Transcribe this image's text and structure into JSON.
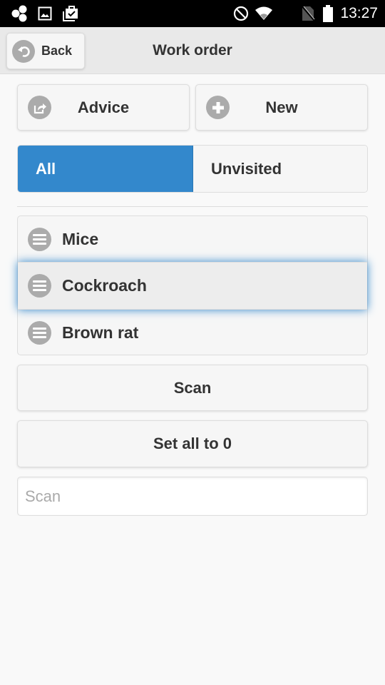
{
  "status_bar": {
    "time": "13:27",
    "icons": [
      "app-notification-icon",
      "image-notification-icon",
      "clipboard-check-icon",
      "do-not-disturb-icon",
      "wifi-icon",
      "no-sim-icon",
      "battery-icon"
    ]
  },
  "header": {
    "back_label": "Back",
    "title": "Work order"
  },
  "actions": {
    "advice_label": "Advice",
    "new_label": "New"
  },
  "filter_tabs": [
    {
      "label": "All",
      "active": true
    },
    {
      "label": "Unvisited",
      "active": false
    }
  ],
  "pest_list": [
    {
      "label": "Mice",
      "focused": false
    },
    {
      "label": "Cockroach",
      "focused": true
    },
    {
      "label": "Brown rat",
      "focused": false
    }
  ],
  "buttons": {
    "scan_label": "Scan",
    "set_all_label": "Set all to 0"
  },
  "scan_input": {
    "value": "",
    "placeholder": "Scan"
  },
  "colors": {
    "accent": "#3388cc",
    "icon_gray": "#ababab",
    "header_bg": "#e9e9e9"
  }
}
